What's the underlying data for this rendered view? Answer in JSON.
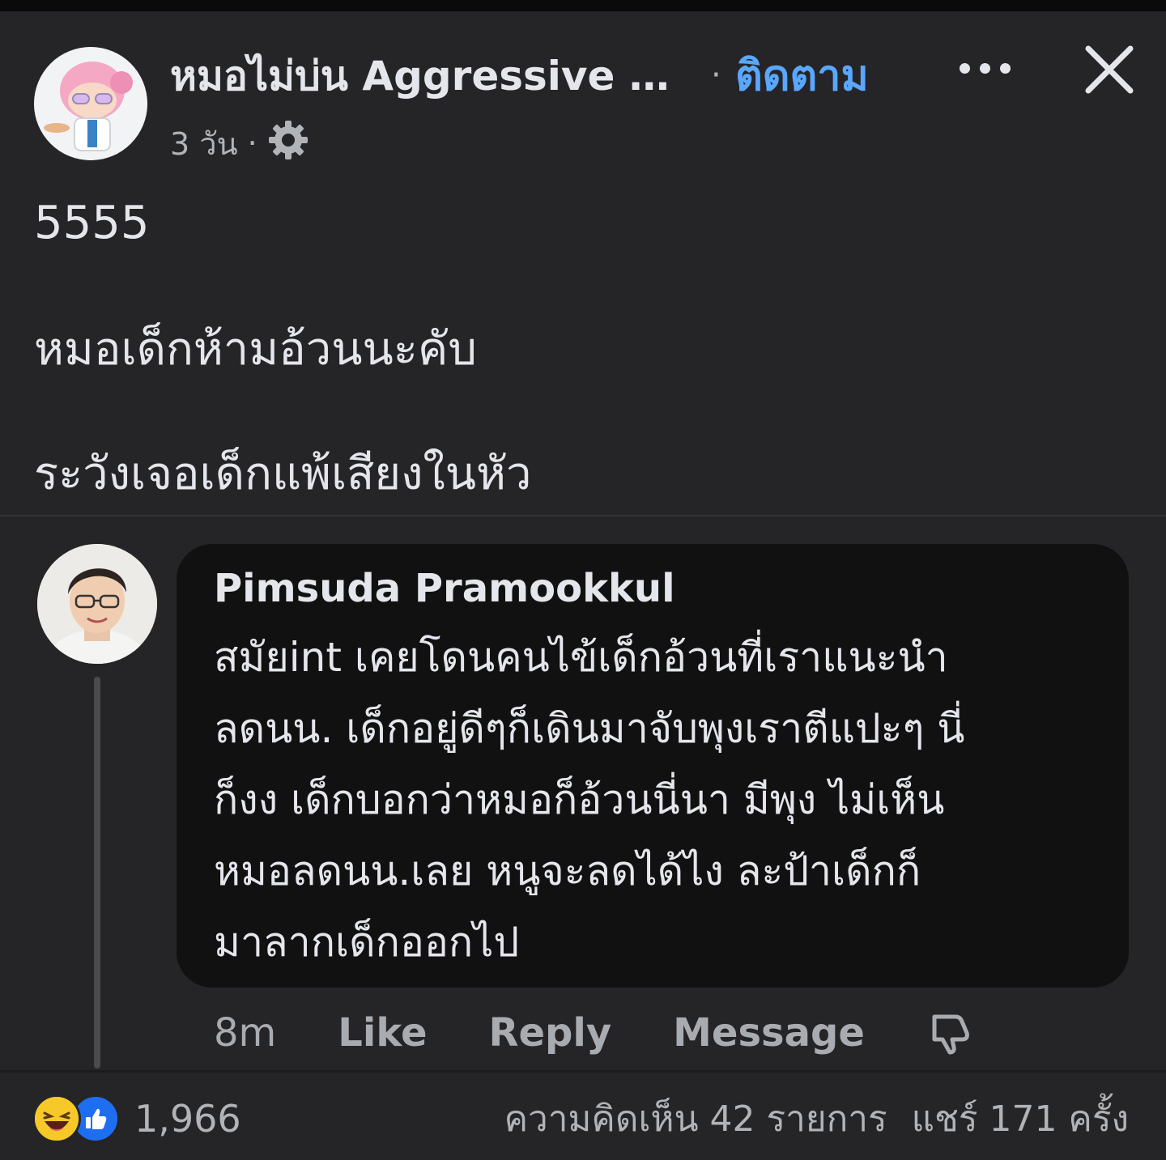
{
  "post": {
    "page_name": "หมอไม่บ่น Aggressive …",
    "separator": "·",
    "follow_label": "ติดตาม",
    "time": "3 วัน",
    "meta_separator": "·",
    "icons": {
      "audience": "gear-icon",
      "more": "more-icon",
      "close": "close-icon"
    },
    "lines": [
      "5555",
      "หมอเด็กห้ามอ้วนนะคับ",
      "ระวังเจอเด็กแพ้เสียงในหัว"
    ]
  },
  "comment": {
    "author": "Pimsuda Pramookkul",
    "lines": [
      "สมัยint เคยโดนคนไข้เด็กอ้วนที่เราแนะนำ",
      "ลดนน. เด็กอยู่ดีๆก็เดินมาจับพุงเราตีแปะๆ นี่",
      "ก็งง เด็กบอกว่าหมอก็อ้วนนี่นา มีพุง ไม่เห็น",
      "หมอลดนน.เลย หนูจะลดได้ไง  ละป้าเด็กก็",
      "มาลากเด็กออกไป"
    ],
    "time": "8m",
    "like_label": "Like",
    "reply_label": "Reply",
    "message_label": "Message",
    "dislike_icon": "dislike-icon"
  },
  "footer": {
    "reaction_icons": [
      "haha-icon",
      "like-icon"
    ],
    "reaction_count": "1,966",
    "comments_label": "ความคิดเห็น 42 รายการ",
    "shares_label": "แชร์ 171 ครั้ง"
  },
  "colors": {
    "background": "#252527",
    "bubble": "#111112",
    "accent": "#5aa7ff",
    "text": "#e4e6eb",
    "muted": "#b0b3b8"
  }
}
